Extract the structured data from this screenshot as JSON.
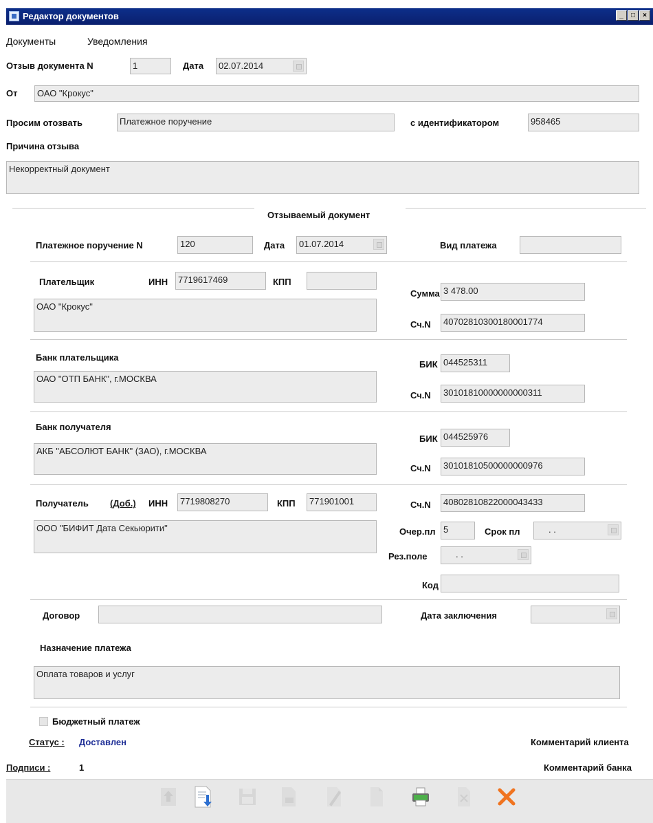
{
  "window": {
    "title": "Редактор документов"
  },
  "menu": [
    "Документы",
    "Уведомления"
  ],
  "header": {
    "doc_no_label": "Отзыв документа N",
    "doc_no": "1",
    "date_label": "Дата",
    "date": "02.07.2014",
    "from_label": "От",
    "from": "ОАО \"Крокус\"",
    "request_label": "Просим отозвать",
    "request": "Платежное поручение",
    "id_label": "с идентификатором",
    "id": "958465",
    "reason_label": "Причина отзыва",
    "reason": "Некорректный документ"
  },
  "section_title": "Отзываемый документ",
  "payment": {
    "order_label": "Платежное поручение N",
    "order_no": "120",
    "date_label": "Дата",
    "date": "01.07.2014",
    "kind_label": "Вид платежа",
    "kind": ""
  },
  "payer": {
    "label": "Плательщик",
    "inn_label": "ИНН",
    "inn": "7719617469",
    "kpp_label": "КПП",
    "kpp": "",
    "name": "ОАО \"Крокус\"",
    "sum_label": "Сумма",
    "sum": "3 478.00",
    "acc_label": "Сч.N",
    "acc": "40702810300180001774"
  },
  "payer_bank": {
    "label": "Банк плательщика",
    "name": "ОАО \"ОТП БАНК\", г.МОСКВА",
    "bik_label": "БИК",
    "bik": "044525311",
    "acc_label": "Сч.N",
    "acc": "30101810000000000311"
  },
  "recipient_bank": {
    "label": "Банк получателя",
    "name": "АКБ \"АБСОЛЮТ БАНК\" (ЗАО), г.МОСКВА",
    "bik_label": "БИК",
    "bik": "044525976",
    "acc_label": "Сч.N",
    "acc": "30101810500000000976"
  },
  "recipient": {
    "label": "Получатель",
    "add_link": "(Доб.)",
    "inn_label": "ИНН",
    "inn": "7719808270",
    "kpp_label": "КПП",
    "kpp": "771901001",
    "name": "ООО \"БИФИТ Дата Секьюрити\"",
    "acc_label": "Сч.N",
    "acc": "40802810822000043433",
    "queue_label": "Очер.пл",
    "queue": "5",
    "term_label": "Срок пл",
    "term": ". .",
    "reserve_label": "Рез.поле",
    "reserve": ". .",
    "code_label": "Код",
    "code": ""
  },
  "contract": {
    "label": "Договор",
    "value": "",
    "date_label": "Дата заключения",
    "date": ""
  },
  "purpose": {
    "label": "Назначение платежа",
    "value": "Оплата товаров и услуг"
  },
  "budget_label": "Бюджетный платеж",
  "status": {
    "label": "Статус :",
    "value": "Доставлен",
    "client_comment": "Комментарий клиента"
  },
  "signatures": {
    "label": "Подписи :",
    "value": "1",
    "bank_comment": "Комментарий банка"
  },
  "toolbar_icons": [
    "export-icon",
    "import-icon",
    "save-icon",
    "template-icon",
    "edit-icon",
    "copy-icon",
    "print-icon",
    "delete-icon",
    "close-icon"
  ]
}
